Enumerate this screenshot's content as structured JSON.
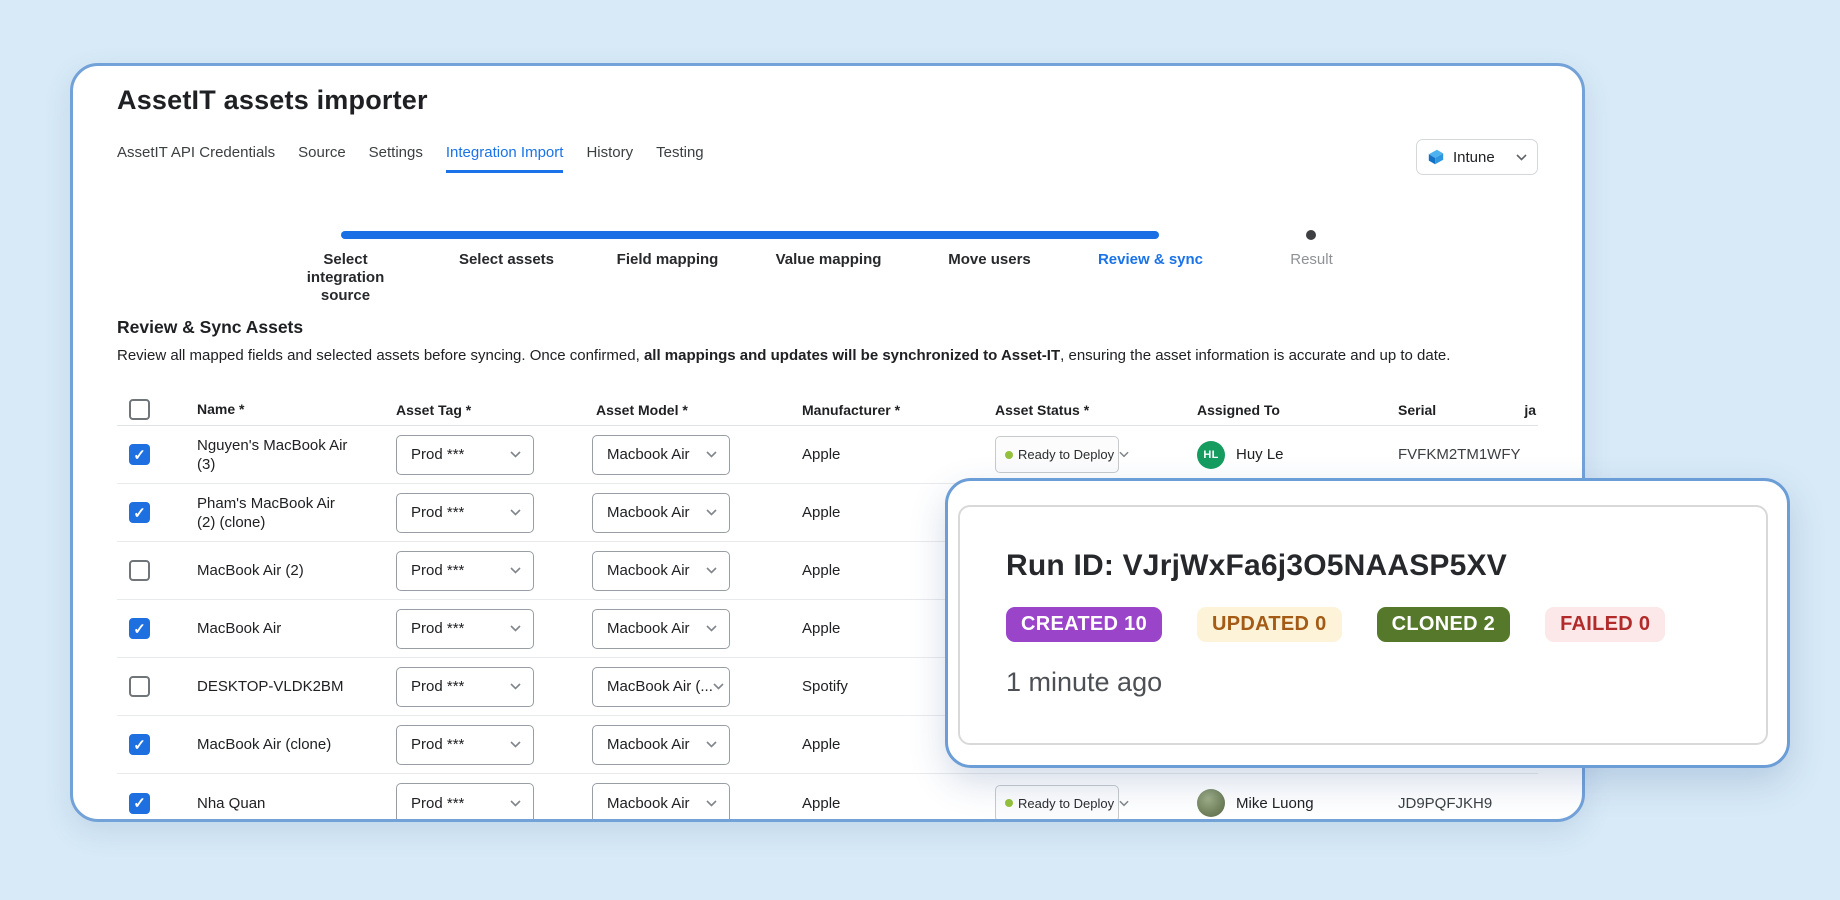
{
  "window": {
    "title": "AssetIT assets importer",
    "tabs": [
      {
        "label": "AssetIT API Credentials",
        "active": false
      },
      {
        "label": "Source",
        "active": false
      },
      {
        "label": "Settings",
        "active": false
      },
      {
        "label": "Integration Import",
        "active": true
      },
      {
        "label": "History",
        "active": false
      },
      {
        "label": "Testing",
        "active": false
      }
    ],
    "integration_select": {
      "value": "Intune"
    }
  },
  "stepper": {
    "steps": [
      {
        "label": "Select integration source",
        "state": "done"
      },
      {
        "label": "Select assets",
        "state": "done"
      },
      {
        "label": "Field mapping",
        "state": "done"
      },
      {
        "label": "Value mapping",
        "state": "done"
      },
      {
        "label": "Move users",
        "state": "done"
      },
      {
        "label": "Review & sync",
        "state": "current"
      },
      {
        "label": "Result",
        "state": "pending"
      }
    ]
  },
  "section": {
    "heading": "Review & Sync Assets",
    "description_before": "Review all mapped fields and selected assets before syncing. Once confirmed, ",
    "description_bold": "all mappings and updates will be synchronized to Asset-IT",
    "description_after": ", ensuring the asset information is accurate and up to date."
  },
  "table": {
    "headers": [
      "Name *",
      "Asset Tag *",
      "Asset Model *",
      "Manufacturer *",
      "Asset Status *",
      "Assigned To",
      "Serial",
      "ja"
    ],
    "rows": [
      {
        "checked": true,
        "name": "Nguyen's MacBook Air (3)",
        "asset_tag": "Prod ***",
        "asset_model": "Macbook Air",
        "manufacturer": "Apple",
        "asset_status": "Ready to Deploy",
        "assignee": {
          "initials": "HL",
          "name": "Huy Le"
        },
        "serial": "FVFKM2TM1WFY"
      },
      {
        "checked": true,
        "name": "Pham's MacBook Air (2) (clone)",
        "asset_tag": "Prod ***",
        "asset_model": "Macbook Air",
        "manufacturer": "Apple"
      },
      {
        "checked": false,
        "name": "MacBook Air (2)",
        "asset_tag": "Prod ***",
        "asset_model": "Macbook Air",
        "manufacturer": "Apple"
      },
      {
        "checked": true,
        "name": "MacBook Air",
        "asset_tag": "Prod ***",
        "asset_model": "Macbook Air",
        "manufacturer": "Apple"
      },
      {
        "checked": false,
        "name": "DESKTOP-VLDK2BM",
        "asset_tag": "Prod ***",
        "asset_model": "MacBook Air (...",
        "manufacturer": "Spotify"
      },
      {
        "checked": true,
        "name": "MacBook Air (clone)",
        "asset_tag": "Prod ***",
        "asset_model": "Macbook Air",
        "manufacturer": "Apple"
      },
      {
        "checked": true,
        "name": "Nha Quan",
        "asset_tag": "Prod ***",
        "asset_model": "Macbook Air",
        "manufacturer": "Apple",
        "asset_status": "Ready to Deploy",
        "assignee": {
          "name": "Mike Luong"
        },
        "serial": "JD9PQFJKH9"
      }
    ]
  },
  "popup": {
    "run_id_label": "Run ID:",
    "run_id": "VJrjWxFa6j3O5NAASP5XV",
    "badges": [
      {
        "label": "CREATED 10",
        "bg": "#9a44ca",
        "fg": "#ffffff"
      },
      {
        "label": "UPDATED 0",
        "bg": "#fcf3d9",
        "fg": "#a35b15"
      },
      {
        "label": "CLONED 2",
        "bg": "#55782a",
        "fg": "#ffffff"
      },
      {
        "label": "FAILED 0",
        "bg": "#fce8e8",
        "fg": "#b22b2b"
      }
    ],
    "timestamp": "1 minute ago"
  },
  "colors": {
    "accent_blue": "#1a73e8",
    "window_border": "#73a2d8",
    "status_dot_green": "#94c13d",
    "avatar_green": "#169c5f",
    "checkbox_blue": "#1e6fe0"
  }
}
